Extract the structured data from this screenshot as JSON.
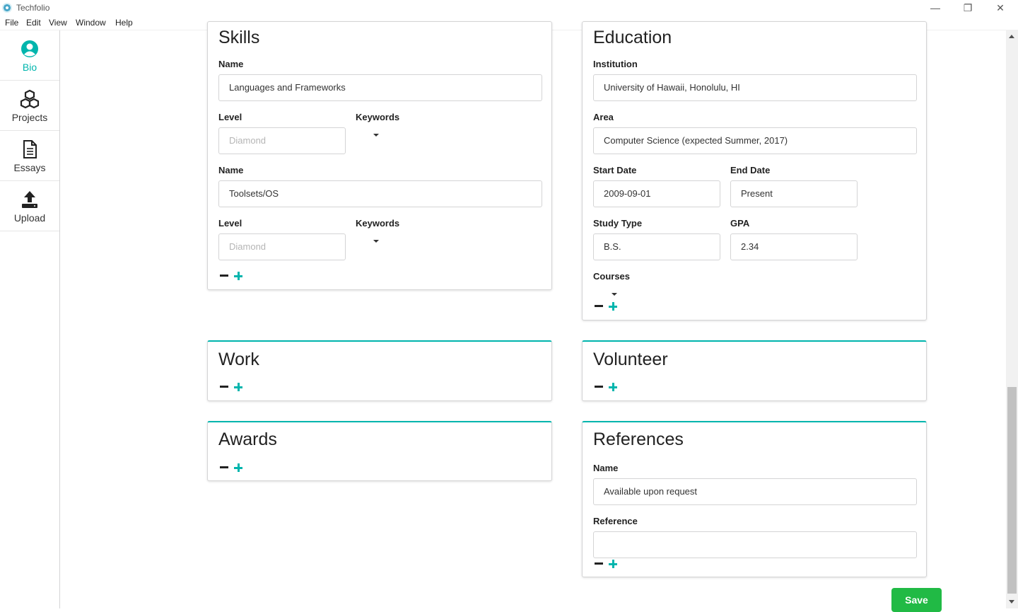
{
  "window": {
    "title": "Techfolio",
    "minimize": "—",
    "maximize": "❐",
    "close": "✕"
  },
  "menu": [
    "File",
    "Edit",
    "View",
    "Window",
    "Help"
  ],
  "sidebar": {
    "items": [
      {
        "label": "Bio",
        "icon": "user-circle-icon",
        "active": true
      },
      {
        "label": "Projects",
        "icon": "cubes-icon"
      },
      {
        "label": "Essays",
        "icon": "file-icon"
      },
      {
        "label": "Upload",
        "icon": "upload-icon"
      }
    ]
  },
  "skills": {
    "title": "Skills",
    "name_label": "Name",
    "level_label": "Level",
    "keywords_label": "Keywords",
    "entries": [
      {
        "name": "Languages and Frameworks",
        "level_placeholder": "Diamond"
      },
      {
        "name": "Toolsets/OS",
        "level_placeholder": "Diamond"
      }
    ]
  },
  "education": {
    "title": "Education",
    "institution_label": "Institution",
    "institution": "University of Hawaii, Honolulu, HI",
    "area_label": "Area",
    "area": "Computer Science (expected Summer, 2017)",
    "start_label": "Start Date",
    "start": "2009-09-01",
    "end_label": "End Date",
    "end": "Present",
    "study_type_label": "Study Type",
    "study_type": "B.S.",
    "gpa_label": "GPA",
    "gpa": "2.34",
    "courses_label": "Courses"
  },
  "work": {
    "title": "Work"
  },
  "volunteer": {
    "title": "Volunteer"
  },
  "awards": {
    "title": "Awards"
  },
  "references": {
    "title": "References",
    "name_label": "Name",
    "name": "Available upon request",
    "reference_label": "Reference",
    "reference": ""
  },
  "save_label": "Save",
  "colors": {
    "accent": "#00b5ad",
    "save": "#21ba45"
  }
}
